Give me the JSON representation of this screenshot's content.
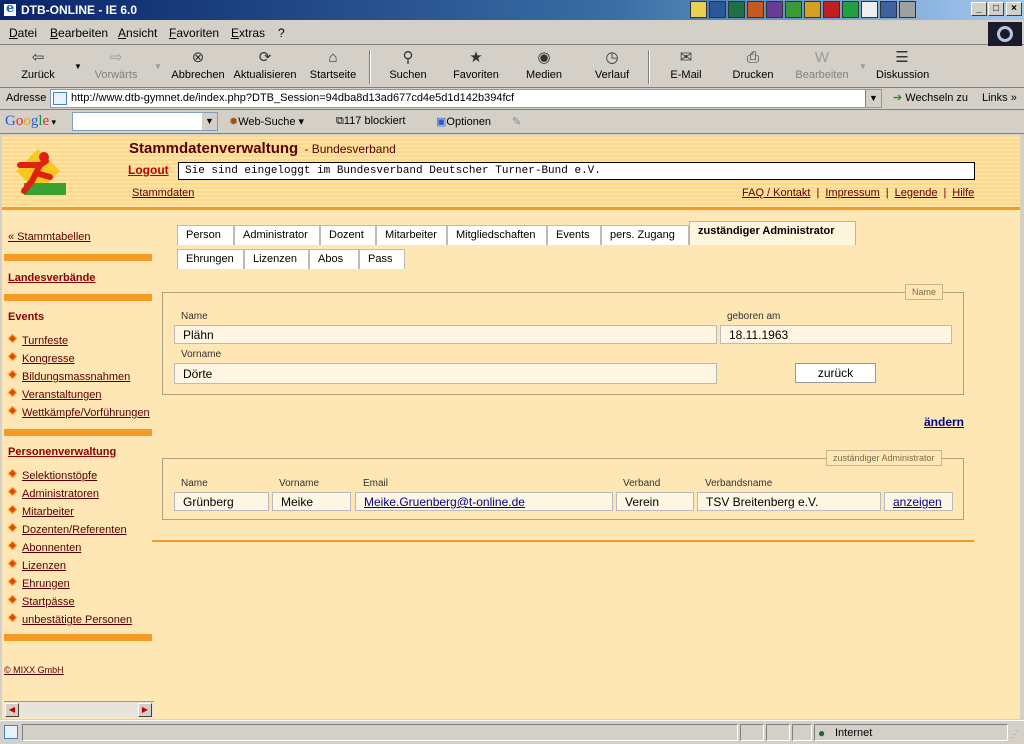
{
  "window": {
    "title": "DTB-ONLINE - IE 6.0"
  },
  "menu": [
    "Datei",
    "Bearbeiten",
    "Ansicht",
    "Favoriten",
    "Extras",
    "?"
  ],
  "toolbar": {
    "back": "Zurück",
    "forward": "Vorwärts",
    "stop": "Abbrechen",
    "refresh": "Aktualisieren",
    "home": "Startseite",
    "search": "Suchen",
    "favorites": "Favoriten",
    "media": "Medien",
    "history": "Verlauf",
    "email": "E-Mail",
    "print": "Drucken",
    "edit": "Bearbeiten",
    "discuss": "Diskussion"
  },
  "address": {
    "label": "Adresse",
    "url": "http://www.dtb-gymnet.de/index.php?DTB_Session=94dba8d13ad677cd4e5d1d142b394fcf",
    "goto": "Wechseln zu",
    "links": "Links"
  },
  "google": {
    "logo": "Google",
    "search_value": "",
    "websearch": "Web-Suche",
    "blocked": "117 blockiert",
    "options": "Optionen"
  },
  "header": {
    "app_title": "Stammdatenverwaltung",
    "app_subtitle": "- Bundesverband",
    "logout": "Logout",
    "login_message": "Sie sind eingeloggt im Bundesverband Deutscher Turner-Bund e.V.",
    "breadcrumb": "Stammdaten",
    "links": [
      "FAQ / Kontakt",
      "Impressum",
      "Legende",
      "Hilfe"
    ]
  },
  "sidebar": {
    "back_link": "« Stammtabellen",
    "landesverbaende": "Landesverbände",
    "events_heading": "Events",
    "events": [
      "Turnfeste",
      "Kongresse",
      "Bildungsmassnahmen",
      "Veranstaltungen",
      "Wettkämpfe/Vorführungen"
    ],
    "persons_heading": "Personenverwaltung",
    "persons": [
      "Selektionstöpfe",
      "Administratoren",
      "Mitarbeiter",
      "Dozenten/Referenten",
      "Abonnenten",
      "Lizenzen",
      "Ehrungen",
      "Startpässe",
      "unbestätigte Personen"
    ],
    "copyright": "© MIXX GmbH"
  },
  "tabs": {
    "row1": [
      "Person",
      "Administrator",
      "Dozent",
      "Mitarbeiter",
      "Mitgliedschaften",
      "Events",
      "pers. Zugang",
      "zuständiger Administrator"
    ],
    "row2": [
      "Ehrungen",
      "Lizenzen",
      "Abos",
      "Pass"
    ],
    "active": "zuständiger Administrator"
  },
  "name_panel": {
    "legend": "Name",
    "name_label": "Name",
    "name_value": "Plähn",
    "birth_label": "geboren am",
    "birth_value": "18.11.1963",
    "firstname_label": "Vorname",
    "firstname_value": "Dörte",
    "back_button": "zurück"
  },
  "edit_link": "ändern",
  "admin_panel": {
    "legend": "zuständiger Administrator",
    "labels": {
      "name": "Name",
      "firstname": "Vorname",
      "email": "Email",
      "verband": "Verband",
      "verbandsname": "Verbandsname"
    },
    "values": {
      "name": "Grünberg",
      "firstname": "Meike",
      "email": "Meike.Gruenberg@t-online.de",
      "verband": "Verein",
      "verbandsname": "TSV Breitenberg e.V."
    },
    "show_button": "anzeigen"
  },
  "status": {
    "zone": "Internet"
  }
}
